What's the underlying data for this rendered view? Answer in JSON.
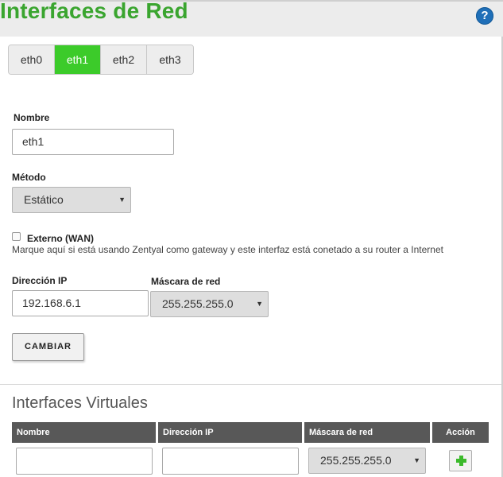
{
  "header": {
    "title": "Interfaces de Red",
    "help_icon": "question-circle-icon",
    "help_glyph": "?"
  },
  "tabs": [
    {
      "label": "eth0",
      "active": false
    },
    {
      "label": "eth1",
      "active": true
    },
    {
      "label": "eth2",
      "active": false
    },
    {
      "label": "eth3",
      "active": false
    }
  ],
  "form": {
    "name_label": "Nombre",
    "name_value": "eth1",
    "method_label": "Método",
    "method_value": "Estático",
    "external_label": "Externo (WAN)",
    "external_checked": false,
    "external_help": "Marque aquí si está usando Zentyal como gateway y este interfaz está conetado a su router a Internet",
    "ip_label": "Dirección IP",
    "ip_value": "192.168.6.1",
    "mask_label": "Máscara de red",
    "mask_value": "255.255.255.0",
    "change_button": "CAMBIAR"
  },
  "virtual": {
    "title": "Interfaces Virtuales",
    "columns": [
      "Nombre",
      "Dirección IP",
      "Máscara de red",
      "Acción"
    ],
    "new_row": {
      "name": "",
      "ip": "",
      "mask": "255.255.255.0",
      "action_icon": "plus-icon"
    }
  },
  "colors": {
    "accent": "#3aa52f",
    "active_tab": "#3ccb2a",
    "table_header": "#585858",
    "help": "#1f6fb8"
  },
  "caret_glyph": "▼"
}
